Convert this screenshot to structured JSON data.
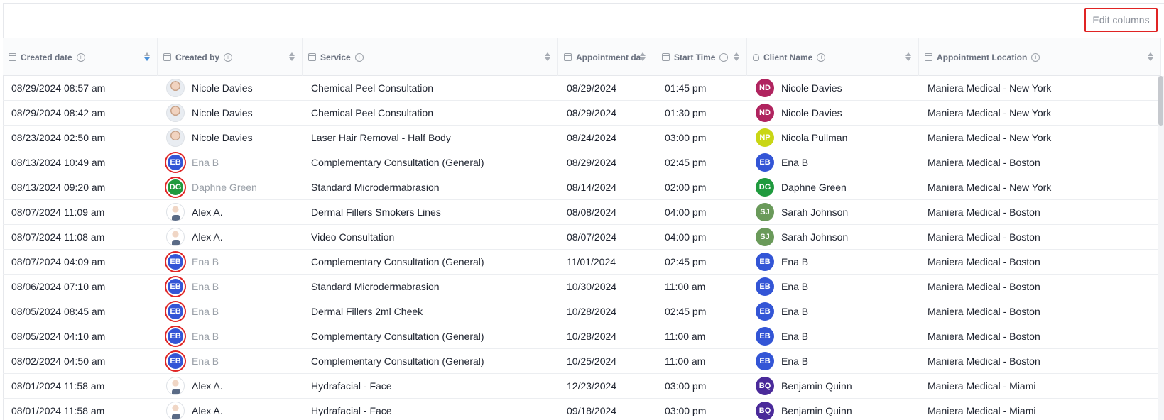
{
  "toolbar": {
    "edit_columns_label": "Edit columns"
  },
  "columns": [
    {
      "key": "created_date",
      "label": "Created date",
      "icon": "calendar-icon",
      "sort_active": true
    },
    {
      "key": "created_by",
      "label": "Created by",
      "icon": "calendar-icon",
      "sort_active": false
    },
    {
      "key": "service",
      "label": "Service",
      "icon": "calendar-icon",
      "sort_active": false
    },
    {
      "key": "appointment_date",
      "label": "Appointment da",
      "icon": "calendar-icon",
      "sort_active": false
    },
    {
      "key": "start_time",
      "label": "Start Time",
      "icon": "calendar-icon",
      "sort_active": false
    },
    {
      "key": "client_name",
      "label": "Client Name",
      "icon": "person-icon",
      "sort_active": false
    },
    {
      "key": "location",
      "label": "Appointment Location",
      "icon": "calendar-icon",
      "sort_active": false
    }
  ],
  "rows": [
    {
      "created_date": "08/29/2024 08:57 am",
      "created_by": {
        "name": "Nicole Davies",
        "avatar": "photo-female"
      },
      "service": "Chemical Peel Consultation",
      "appointment_date": "08/29/2024",
      "start_time": "01:45 pm",
      "client": {
        "initials": "ND",
        "name": "Nicole Davies",
        "color": "#b0245f"
      },
      "location": "Maniera Medical - New York"
    },
    {
      "created_date": "08/29/2024 08:42 am",
      "created_by": {
        "name": "Nicole Davies",
        "avatar": "photo-female"
      },
      "service": "Chemical Peel Consultation",
      "appointment_date": "08/29/2024",
      "start_time": "01:30 pm",
      "client": {
        "initials": "ND",
        "name": "Nicole Davies",
        "color": "#b0245f"
      },
      "location": "Maniera Medical - New York"
    },
    {
      "created_date": "08/23/2024 02:50 am",
      "created_by": {
        "name": "Nicole Davies",
        "avatar": "photo-female"
      },
      "service": "Laser Hair Removal - Half Body",
      "appointment_date": "08/24/2024",
      "start_time": "03:00 pm",
      "client": {
        "initials": "NP",
        "name": "Nicola Pullman",
        "color": "#c9d615"
      },
      "location": "Maniera Medical - New York"
    },
    {
      "created_date": "08/13/2024 10:49 am",
      "created_by": {
        "name": "Ena B",
        "avatar": "initials",
        "initials": "EB",
        "color": "#3355d6",
        "muted": true
      },
      "service": "Complementary Consultation (General)",
      "appointment_date": "08/29/2024",
      "start_time": "02:45 pm",
      "client": {
        "initials": "EB",
        "name": "Ena B",
        "color": "#3355d6"
      },
      "location": "Maniera Medical - Boston"
    },
    {
      "created_date": "08/13/2024 09:20 am",
      "created_by": {
        "name": "Daphne Green",
        "avatar": "initials",
        "initials": "DG",
        "color": "#1f9a3e",
        "muted": true
      },
      "service": "Standard Microdermabrasion",
      "appointment_date": "08/14/2024",
      "start_time": "02:00 pm",
      "client": {
        "initials": "DG",
        "name": "Daphne Green",
        "color": "#1f9a3e"
      },
      "location": "Maniera Medical - New York"
    },
    {
      "created_date": "08/07/2024 11:09 am",
      "created_by": {
        "name": "Alex A.",
        "avatar": "photo-male"
      },
      "service": "Dermal Fillers Smokers Lines",
      "appointment_date": "08/08/2024",
      "start_time": "04:00 pm",
      "client": {
        "initials": "SJ",
        "name": "Sarah Johnson",
        "color": "#6a9a5a"
      },
      "location": "Maniera Medical - Boston"
    },
    {
      "created_date": "08/07/2024 11:08 am",
      "created_by": {
        "name": "Alex A.",
        "avatar": "photo-male"
      },
      "service": "Video Consultation",
      "appointment_date": "08/07/2024",
      "start_time": "04:00 pm",
      "client": {
        "initials": "SJ",
        "name": "Sarah Johnson",
        "color": "#6a9a5a"
      },
      "location": "Maniera Medical - Boston"
    },
    {
      "created_date": "08/07/2024 04:09 am",
      "created_by": {
        "name": "Ena B",
        "avatar": "initials",
        "initials": "EB",
        "color": "#3355d6",
        "muted": true
      },
      "service": "Complementary Consultation (General)",
      "appointment_date": "11/01/2024",
      "start_time": "02:45 pm",
      "client": {
        "initials": "EB",
        "name": "Ena B",
        "color": "#3355d6"
      },
      "location": "Maniera Medical - Boston"
    },
    {
      "created_date": "08/06/2024 07:10 am",
      "created_by": {
        "name": "Ena B",
        "avatar": "initials",
        "initials": "EB",
        "color": "#3355d6",
        "muted": true
      },
      "service": "Standard Microdermabrasion",
      "appointment_date": "10/30/2024",
      "start_time": "11:00 am",
      "client": {
        "initials": "EB",
        "name": "Ena B",
        "color": "#3355d6"
      },
      "location": "Maniera Medical - Boston"
    },
    {
      "created_date": "08/05/2024 08:45 am",
      "created_by": {
        "name": "Ena B",
        "avatar": "initials",
        "initials": "EB",
        "color": "#3355d6",
        "muted": true
      },
      "service": "Dermal Fillers 2ml Cheek",
      "appointment_date": "10/28/2024",
      "start_time": "02:45 pm",
      "client": {
        "initials": "EB",
        "name": "Ena B",
        "color": "#3355d6"
      },
      "location": "Maniera Medical - Boston"
    },
    {
      "created_date": "08/05/2024 04:10 am",
      "created_by": {
        "name": "Ena B",
        "avatar": "initials",
        "initials": "EB",
        "color": "#3355d6",
        "muted": true
      },
      "service": "Complementary Consultation (General)",
      "appointment_date": "10/28/2024",
      "start_time": "11:00 am",
      "client": {
        "initials": "EB",
        "name": "Ena B",
        "color": "#3355d6"
      },
      "location": "Maniera Medical - Boston"
    },
    {
      "created_date": "08/02/2024 04:50 am",
      "created_by": {
        "name": "Ena B",
        "avatar": "initials",
        "initials": "EB",
        "color": "#3355d6",
        "muted": true
      },
      "service": "Complementary Consultation (General)",
      "appointment_date": "10/25/2024",
      "start_time": "11:00 am",
      "client": {
        "initials": "EB",
        "name": "Ena B",
        "color": "#3355d6"
      },
      "location": "Maniera Medical - Boston"
    },
    {
      "created_date": "08/01/2024 11:58 am",
      "created_by": {
        "name": "Alex A.",
        "avatar": "photo-male"
      },
      "service": "Hydrafacial - Face",
      "appointment_date": "12/23/2024",
      "start_time": "03:00 pm",
      "client": {
        "initials": "BQ",
        "name": "Benjamin Quinn",
        "color": "#4a2a9a"
      },
      "location": "Maniera Medical - Miami"
    },
    {
      "created_date": "08/01/2024 11:58 am",
      "created_by": {
        "name": "Alex A.",
        "avatar": "photo-male"
      },
      "service": "Hydrafacial - Face",
      "appointment_date": "09/18/2024",
      "start_time": "03:00 pm",
      "client": {
        "initials": "BQ",
        "name": "Benjamin Quinn",
        "color": "#4a2a9a"
      },
      "location": "Maniera Medical - Miami"
    }
  ]
}
